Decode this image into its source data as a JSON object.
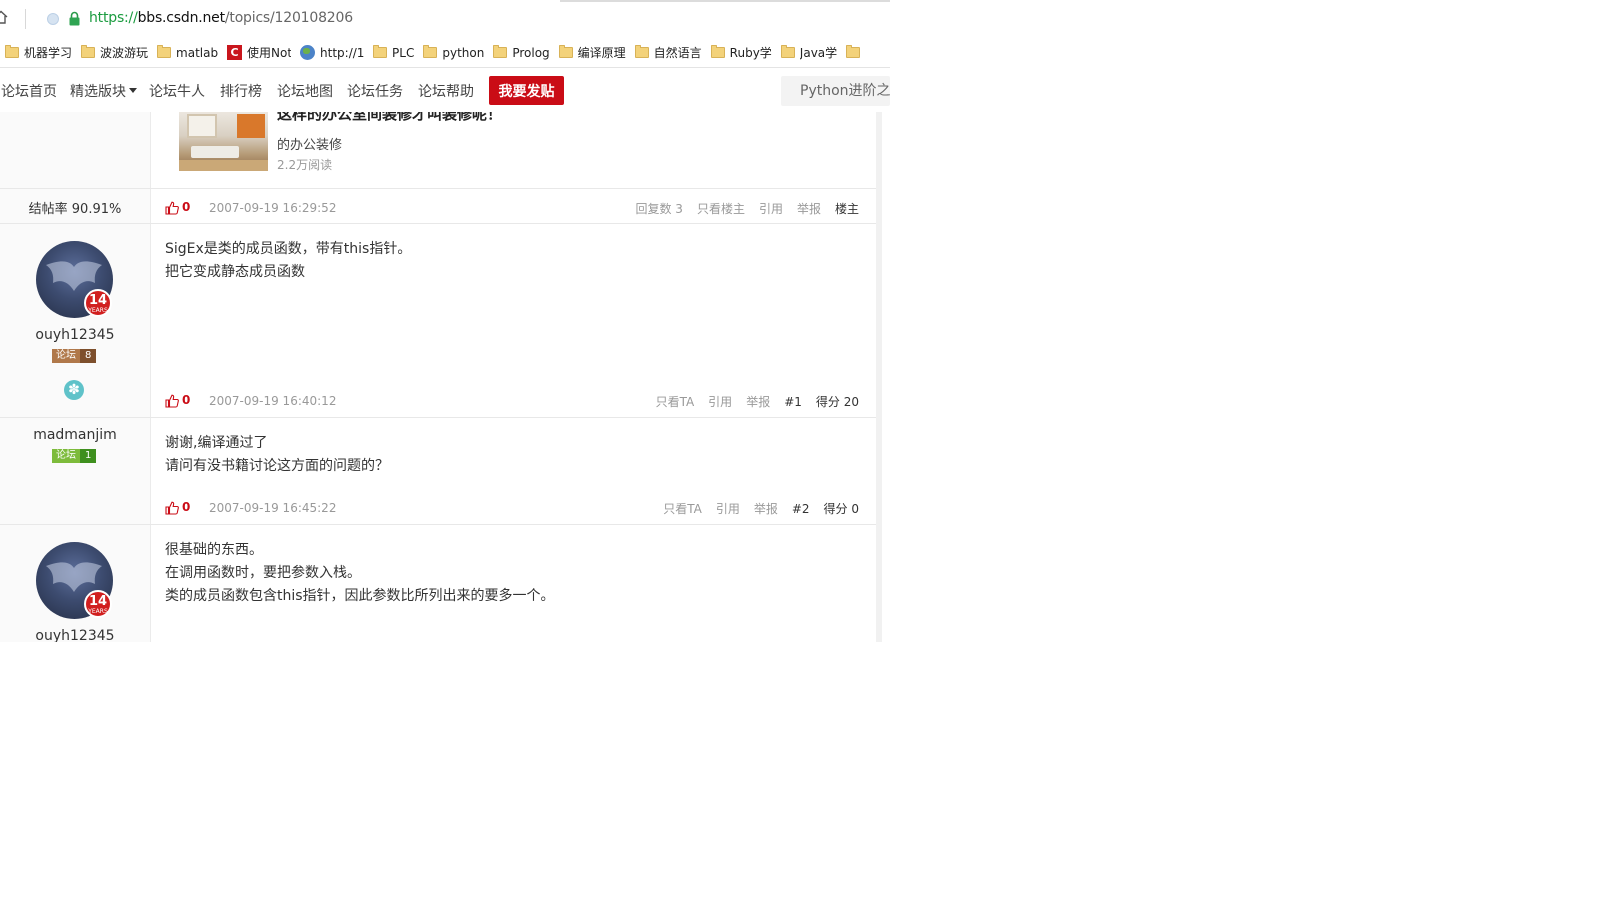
{
  "browser": {
    "url": {
      "scheme": "https://",
      "host": "bbs.csdn.net",
      "path": "/topics/120108206"
    },
    "bookmarks": [
      {
        "icon": "folder-icon",
        "label": "机器学习"
      },
      {
        "icon": "folder-icon",
        "label": "波波游玩"
      },
      {
        "icon": "folder-icon",
        "label": "matlab"
      },
      {
        "icon": "csdn-icon",
        "label": "使用Not"
      },
      {
        "icon": "globe-icon",
        "label": "http://1"
      },
      {
        "icon": "folder-icon",
        "label": "PLC"
      },
      {
        "icon": "folder-icon",
        "label": "python"
      },
      {
        "icon": "folder-icon",
        "label": "Prolog"
      },
      {
        "icon": "folder-icon",
        "label": "编译原理"
      },
      {
        "icon": "folder-icon",
        "label": "自然语言"
      },
      {
        "icon": "folder-icon",
        "label": "Ruby学"
      },
      {
        "icon": "folder-icon",
        "label": "Java学"
      }
    ]
  },
  "nav": {
    "items": [
      "论坛首页",
      "精选版块",
      "论坛牛人",
      "排行榜",
      "论坛地图",
      "论坛任务",
      "论坛帮助"
    ],
    "post_button": "我要发贴",
    "search_placeholder": "Python进阶之"
  },
  "ad": {
    "title": "这样的办公室间装修才叫装修呢！",
    "subtitle": "的办公装修",
    "reads": "2.2万阅读"
  },
  "op_footer": {
    "rate": "结帖率 90.91%",
    "likes": "0",
    "time": "2007-09-19 16:29:52",
    "replies_label": "回复数",
    "replies_count": "3",
    "actions": [
      "只看楼主",
      "引用",
      "举报"
    ],
    "tag": "楼主"
  },
  "posts": [
    {
      "user": "ouyh12345",
      "years": "14",
      "years_label": "YEARS",
      "level_label": "论坛",
      "level": "8",
      "lines": [
        "SigEx是类的成员函数，带有this指针。",
        "把它变成静态成员函数"
      ],
      "likes": "0",
      "time": "2007-09-19 16:40:12",
      "actions": [
        "只看TA",
        "引用",
        "举报"
      ],
      "floor": "#1",
      "score": "得分 20"
    },
    {
      "user": "madmanjim",
      "level_label": "论坛",
      "level": "1",
      "lines": [
        "谢谢,编译通过了",
        "请问有没书籍讨论这方面的问题的？"
      ],
      "likes": "0",
      "time": "2007-09-19 16:45:22",
      "actions": [
        "只看TA",
        "引用",
        "举报"
      ],
      "floor": "#2",
      "score": "得分 0"
    },
    {
      "user": "ouyh12345",
      "years": "14",
      "years_label": "YEARS",
      "lines": [
        "很基础的东西。",
        "在调用函数时，要把参数入栈。",
        "类的成员函数包含this指针，因此参数比所列出来的要多一个。"
      ]
    }
  ]
}
